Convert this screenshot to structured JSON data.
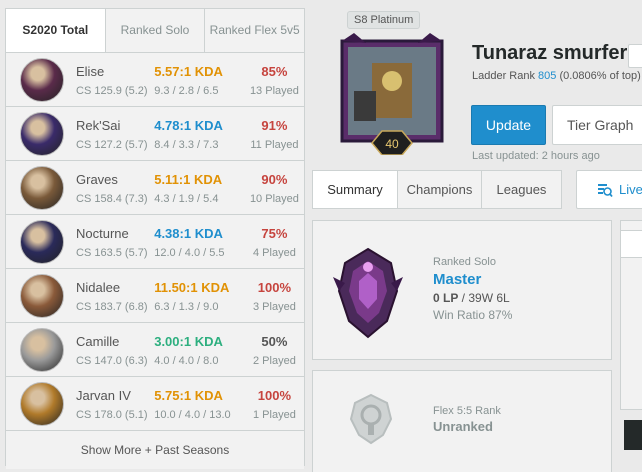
{
  "season_tabs": [
    "S2020 Total",
    "Ranked Solo",
    "Ranked Flex 5v5"
  ],
  "champions": [
    {
      "name": "Elise",
      "cs": "CS 125.9 (5.2)",
      "kda": "5.57:1 KDA",
      "kda_detail": "9.3 / 2.8 / 6.5",
      "winrate": "85%",
      "played": "13 Played",
      "kda_color": "#e19205",
      "wr_color": "#c6443e",
      "avatar_color": "#5a2b4a"
    },
    {
      "name": "Rek'Sai",
      "cs": "CS 127.2 (5.7)",
      "kda": "4.78:1 KDA",
      "kda_detail": "8.4 / 3.3 / 7.3",
      "winrate": "91%",
      "played": "11 Played",
      "kda_color": "#1f8ecd",
      "wr_color": "#c6443e",
      "avatar_color": "#3a2b6a"
    },
    {
      "name": "Graves",
      "cs": "CS 158.4 (7.3)",
      "kda": "5.11:1 KDA",
      "kda_detail": "4.3 / 1.9 / 5.4",
      "winrate": "90%",
      "played": "10 Played",
      "kda_color": "#e19205",
      "wr_color": "#c6443e",
      "avatar_color": "#7a5a3a"
    },
    {
      "name": "Nocturne",
      "cs": "CS 163.5 (5.7)",
      "kda": "4.38:1 KDA",
      "kda_detail": "12.0 / 4.0 / 5.5",
      "winrate": "75%",
      "played": "4 Played",
      "kda_color": "#1f8ecd",
      "wr_color": "#c6443e",
      "avatar_color": "#2a2a5a"
    },
    {
      "name": "Nidalee",
      "cs": "CS 183.7 (6.8)",
      "kda": "11.50:1 KDA",
      "kda_detail": "6.3 / 1.3 / 9.0",
      "winrate": "100%",
      "played": "3 Played",
      "kda_color": "#e19205",
      "wr_color": "#c6443e",
      "avatar_color": "#8a5a3a"
    },
    {
      "name": "Camille",
      "cs": "CS 147.0 (6.3)",
      "kda": "3.00:1 KDA",
      "kda_detail": "4.0 / 4.0 / 8.0",
      "winrate": "50%",
      "played": "2 Played",
      "kda_color": "#2daf7f",
      "wr_color": "#555555",
      "avatar_color": "#9a9a9a"
    },
    {
      "name": "Jarvan IV",
      "cs": "CS 178.0 (5.1)",
      "kda": "5.75:1 KDA",
      "kda_detail": "10.0 / 4.0 / 13.0",
      "winrate": "100%",
      "played": "1 Played",
      "kda_color": "#e19205",
      "wr_color": "#c6443e",
      "avatar_color": "#b07a2a"
    }
  ],
  "show_more": "Show More + Past Seasons",
  "profile": {
    "season_badge": "S8 Platinum",
    "level": "40",
    "name": "Tunaraz smurfer",
    "ladder_prefix": "Ladder Rank ",
    "ladder_rank": "805",
    "ladder_suffix": " (0.0806% of top)",
    "update_label": "Update",
    "tier_graph_label": "Tier Graph",
    "last_updated": "Last updated: 2 hours ago"
  },
  "main_tabs": [
    "Summary",
    "Champions",
    "Leagues"
  ],
  "live_label": "Live",
  "ranked_solo": {
    "queue": "Ranked Solo",
    "tier": "Master",
    "lp": "0 LP",
    "record": " / 39W 6L",
    "win_ratio": "Win Ratio 87%"
  },
  "ranked_flex": {
    "queue": "Flex 5:5 Rank",
    "tier": "Unranked"
  },
  "colors": {
    "accent": "#1f8ecd",
    "panel_bg": "#f2f2f2",
    "border": "#cdd2d2"
  }
}
